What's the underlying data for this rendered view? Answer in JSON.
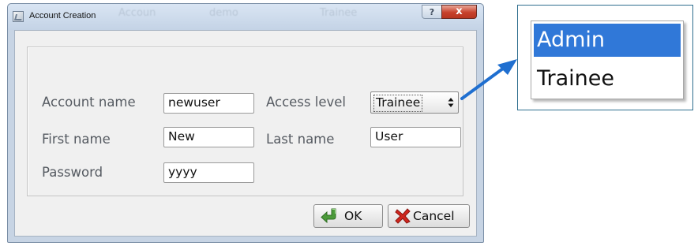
{
  "window": {
    "title": "Account Creation",
    "help_glyph": "?",
    "close_glyph": "x",
    "background_tabs": [
      "Accoun",
      "demo",
      "Trainee"
    ]
  },
  "form": {
    "account_name": {
      "label": "Account name",
      "value": "newuser"
    },
    "access_level": {
      "label": "Access level",
      "value": "Trainee"
    },
    "first_name": {
      "label": "First name",
      "value": "New"
    },
    "last_name": {
      "label": "Last name",
      "value": "User"
    },
    "password": {
      "label": "Password",
      "value": "yyyy"
    }
  },
  "buttons": {
    "ok": {
      "label": "OK",
      "icon": "green-check-arrow-icon"
    },
    "cancel": {
      "label": "Cancel",
      "icon": "red-x-icon"
    }
  },
  "callout": {
    "options": [
      {
        "label": "Admin",
        "selected": true
      },
      {
        "label": "Trainee",
        "selected": false
      }
    ]
  },
  "colors": {
    "selection": "#3078d8",
    "arrow": "#1f6fd0",
    "close_button": "#c7412c",
    "ok_icon": "#4b9a3a",
    "cancel_icon": "#d0271f"
  }
}
